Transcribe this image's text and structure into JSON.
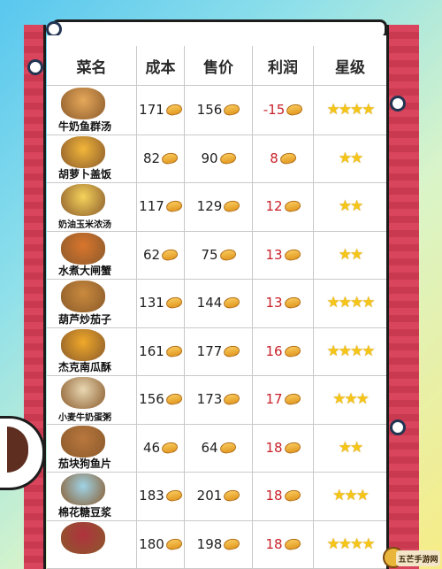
{
  "table": {
    "headers": [
      "菜名",
      "成本",
      "售价",
      "利润",
      "星级"
    ],
    "rows": [
      {
        "name": "牛奶鱼群汤",
        "cost": "171",
        "price": "156",
        "profit": "-15",
        "stars": "★★★★",
        "color": "#e6a85a"
      },
      {
        "name": "胡萝卜盖饭",
        "cost": "82",
        "price": "90",
        "profit": "8",
        "stars": "★★",
        "color": "#f2b63a"
      },
      {
        "name": "奶油玉米浓汤",
        "cost": "117",
        "price": "129",
        "profit": "12",
        "stars": "★★",
        "color": "#f5d35b"
      },
      {
        "name": "水煮大闸蟹",
        "cost": "62",
        "price": "75",
        "profit": "13",
        "stars": "★★",
        "color": "#d9752d"
      },
      {
        "name": "葫芦炒茄子",
        "cost": "131",
        "price": "144",
        "profit": "13",
        "stars": "★★★★",
        "color": "#c98a3d"
      },
      {
        "name": "杰克南瓜酥",
        "cost": "161",
        "price": "177",
        "profit": "16",
        "stars": "★★★★",
        "color": "#f0a92a"
      },
      {
        "name": "小麦牛奶蛋粥",
        "cost": "156",
        "price": "173",
        "profit": "17",
        "stars": "★★★",
        "color": "#e8d7b3"
      },
      {
        "name": "茄块狗鱼片",
        "cost": "46",
        "price": "64",
        "profit": "18",
        "stars": "★★",
        "color": "#b9773e"
      },
      {
        "name": "棉花糖豆浆",
        "cost": "183",
        "price": "201",
        "profit": "18",
        "stars": "★★★",
        "color": "#9fd3e6"
      },
      {
        "name": "",
        "cost": "180",
        "price": "198",
        "profit": "18",
        "stars": "★★★★",
        "color": "#b0323e"
      }
    ]
  },
  "watermark": {
    "text": "五芒手游网"
  }
}
